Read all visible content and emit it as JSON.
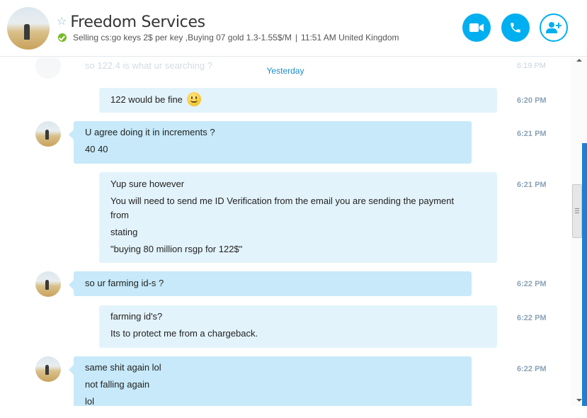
{
  "header": {
    "contact_name": "Freedom Services",
    "mood_message": "Selling cs:go keys 2$ per key ,Buying 07 gold 1.3-1.55$/M",
    "separator": "|",
    "local_time": "11:51 AM United Kingdom",
    "presence": "online",
    "accent_color": "#00aff0",
    "buttons": [
      {
        "icon": "video-call-icon"
      },
      {
        "icon": "audio-call-icon"
      },
      {
        "icon": "add-people-icon"
      }
    ]
  },
  "conversation": {
    "faded_text": "so 122.4 is what ur searching ?",
    "faded_time": "6:19 PM",
    "day_separator": "Yesterday",
    "messages": [
      {
        "direction": "out",
        "lines": [
          "122 would be fine"
        ],
        "emoji": "smile-emoji-icon",
        "time": "6:20 PM"
      },
      {
        "direction": "in",
        "lines": [
          "U agree doing it in increments ?",
          "40 40"
        ],
        "time": "6:21 PM"
      },
      {
        "direction": "out",
        "lines": [
          "Yup sure however",
          "You will need to send me ID Verification from the email you are sending the payment",
          "from",
          "stating",
          "\"buying 80 million rsgp for 122$\""
        ],
        "time": "6:21 PM"
      },
      {
        "direction": "in",
        "lines": [
          "so ur farming id-s ?"
        ],
        "time": "6:22 PM"
      },
      {
        "direction": "out",
        "lines": [
          "farming id's?",
          "Its to protect me from a chargeback."
        ],
        "time": "6:22 PM"
      },
      {
        "direction": "in",
        "lines": [
          "same shit again lol",
          "not falling again",
          "lol"
        ],
        "time": "6:22 PM"
      }
    ]
  },
  "colors": {
    "incoming_bubble": "#c7e9f9",
    "outgoing_bubble": "#e3f3fb",
    "day_separator": "#1b8bcb",
    "timestamp": "#8aa3b6"
  }
}
